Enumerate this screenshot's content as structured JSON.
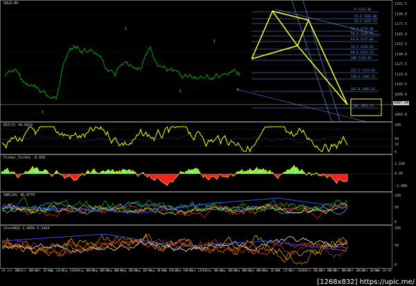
{
  "main_pane": {
    "title": "GOLD,H4",
    "current_price_tag": "1087.44"
  },
  "panes": [
    {
      "id": "rsi",
      "label": "RSI(5) 44.6016"
    },
    {
      "id": "fisher",
      "label": "Fisher_Yur4ik -0.059"
    },
    {
      "id": "var",
      "label": "VAR(34) 96.6770"
    },
    {
      "id": "stoch",
      "label": "StochRSI 2.4956 5.2424"
    }
  ],
  "price_axis": [
    "1202.5",
    "1190.0",
    "1177.5",
    "1165.0",
    "1152.5",
    "1140.0",
    "1127.5",
    "1115.0",
    "1102.5",
    "1090.0",
    "1077.5",
    "1065.0"
  ],
  "rsi_axis": [
    "100",
    "50",
    "32",
    "0"
  ],
  "fisher_axis": [
    "2.168",
    "0.00",
    "-2.488"
  ],
  "var_axis": [
    "100",
    "50",
    "0"
  ],
  "stoch_axis": [
    "100",
    "50",
    "0"
  ],
  "fib_levels": [
    "0 1131.46",
    "23.6 1101.80",
    "23.6 1075.51",
    "50.0 1176.40",
    "50.0 1166.81",
    "61.8 1157.03",
    "76.4 1146.45",
    "88.6 1141.31",
    "100 1126.05",
    "127.2 1113.61",
    "138.2 1105.17",
    "161.8 1092.61",
    "200 1081.62"
  ],
  "x_labels": [
    "20 Jul 2015",
    "24 Jul 04:00",
    "29 Jul 12:00",
    "3 Aug 12:00",
    "6 Aug 16:00",
    "11 Aug 20:00",
    "14 Aug 00:00",
    "17 Aug 08:00",
    "20 Aug 12:00",
    "24 Aug 16:00",
    "27 Aug 20:00",
    "1 Sep 00:00",
    "3 Sep 08:00",
    "8 Sep 12:00",
    "11 Sep 16:00",
    "16 Sep 20:00",
    "21 Sep 00:00",
    "24 Sep 04:00",
    "29 Sep 12:00",
    "2 Oct 12:00",
    "7 Oct 16:00",
    "12 Oct 20:00",
    "15 Oct 00:00",
    "20 Oct 08:00",
    "23 Oct 12:00",
    "28 Oct 16:00",
    "2 Nov 20:00"
  ],
  "watermark": "[1268x832] https://upic.me/",
  "colors": {
    "price": "#00c800",
    "rsi": "#ffff00",
    "fisher_up": "#80ff60",
    "fisher_down": "#ff2020",
    "pattern": "#ffff33",
    "fib": "#6fa0ff"
  }
}
